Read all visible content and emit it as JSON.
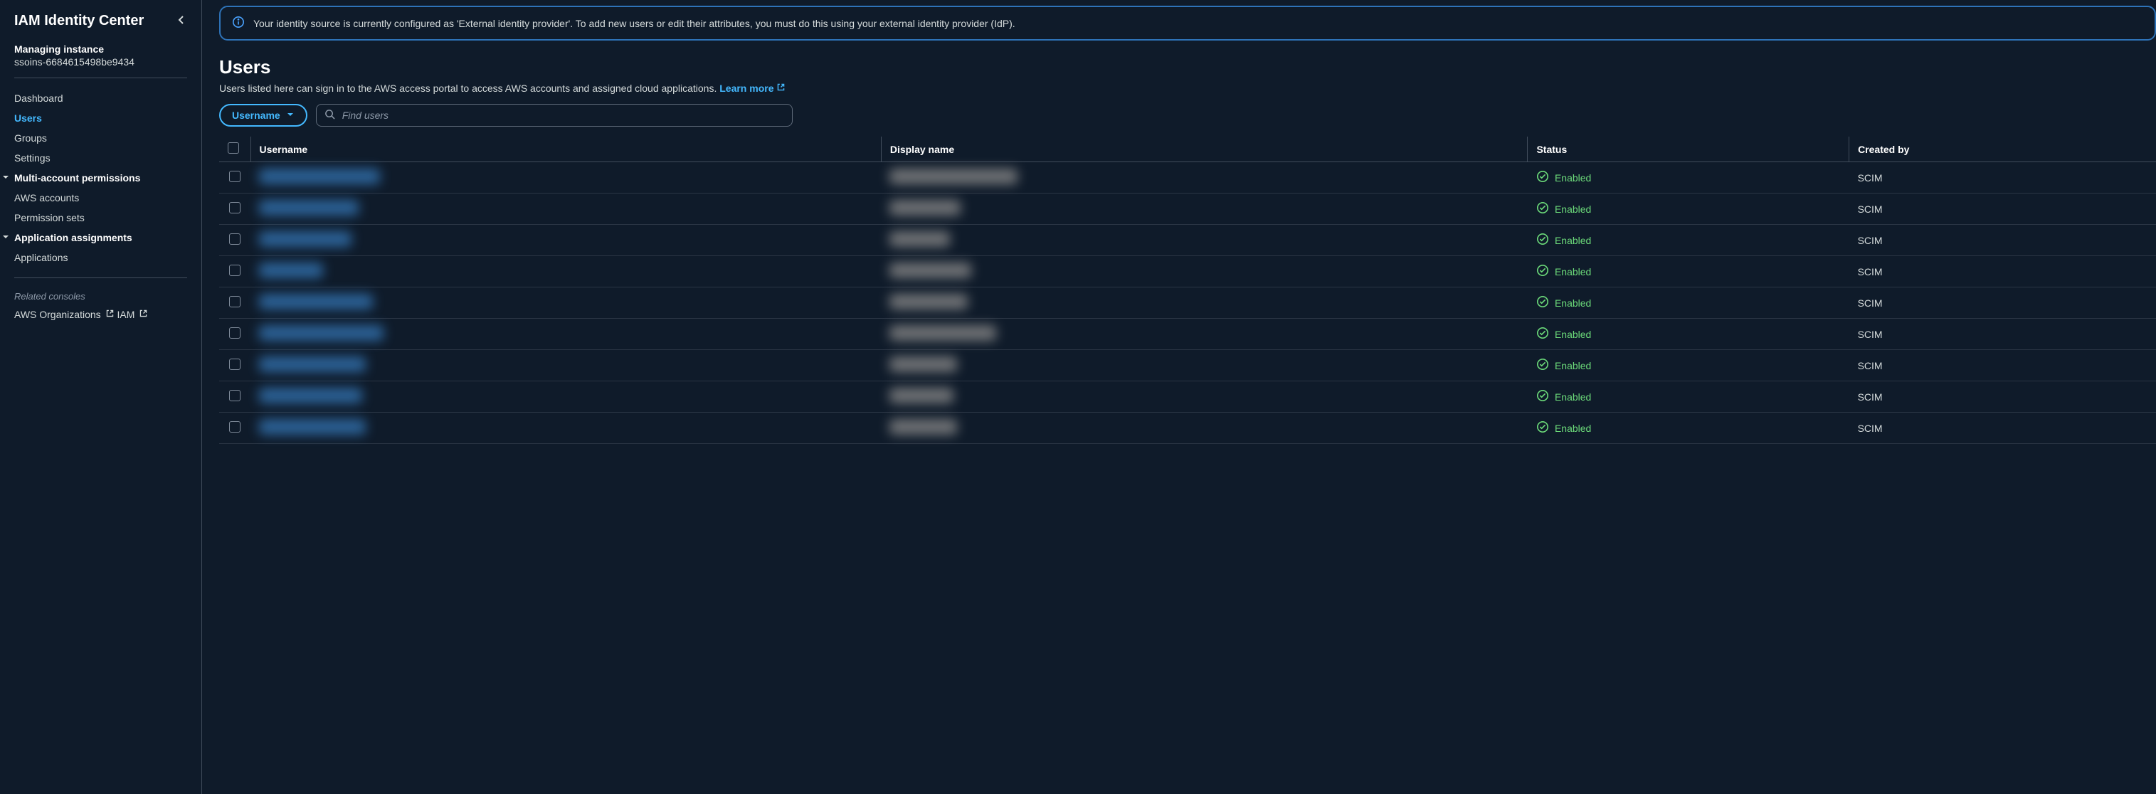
{
  "sidebar": {
    "title": "IAM Identity Center",
    "instance_label": "Managing instance",
    "instance_id": "ssoins-6684615498be9434",
    "nav": [
      {
        "label": "Dashboard",
        "active": false
      },
      {
        "label": "Users",
        "active": true
      },
      {
        "label": "Groups",
        "active": false
      },
      {
        "label": "Settings",
        "active": false
      }
    ],
    "section1": {
      "label": "Multi-account permissions",
      "items": [
        {
          "label": "AWS accounts"
        },
        {
          "label": "Permission sets"
        }
      ]
    },
    "section2": {
      "label": "Application assignments",
      "items": [
        {
          "label": "Applications"
        }
      ]
    },
    "related_label": "Related consoles",
    "related": [
      {
        "label": "AWS Organizations"
      },
      {
        "label": "IAM"
      }
    ]
  },
  "banner": {
    "text": "Your identity source is currently configured as 'External identity provider'. To add new users or edit their attributes, you must do this using your external identity provider (IdP)."
  },
  "page": {
    "title": "Users",
    "description": "Users listed here can sign in to the AWS access portal to access AWS accounts and assigned cloud applications.",
    "learn_more": "Learn more"
  },
  "toolbar": {
    "filter_label": "Username",
    "search_placeholder": "Find users"
  },
  "table": {
    "headers": {
      "username": "Username",
      "display_name": "Display name",
      "status": "Status",
      "created_by": "Created by"
    },
    "rows": [
      {
        "uw": 170,
        "dw": 180,
        "status": "Enabled",
        "created_by": "SCIM"
      },
      {
        "uw": 140,
        "dw": 100,
        "status": "Enabled",
        "created_by": "SCIM"
      },
      {
        "uw": 130,
        "dw": 85,
        "status": "Enabled",
        "created_by": "SCIM"
      },
      {
        "uw": 90,
        "dw": 115,
        "status": "Enabled",
        "created_by": "SCIM"
      },
      {
        "uw": 160,
        "dw": 110,
        "status": "Enabled",
        "created_by": "SCIM"
      },
      {
        "uw": 175,
        "dw": 150,
        "status": "Enabled",
        "created_by": "SCIM"
      },
      {
        "uw": 150,
        "dw": 95,
        "status": "Enabled",
        "created_by": "SCIM"
      },
      {
        "uw": 145,
        "dw": 90,
        "status": "Enabled",
        "created_by": "SCIM"
      },
      {
        "uw": 150,
        "dw": 95,
        "status": "Enabled",
        "created_by": "SCIM"
      }
    ]
  }
}
